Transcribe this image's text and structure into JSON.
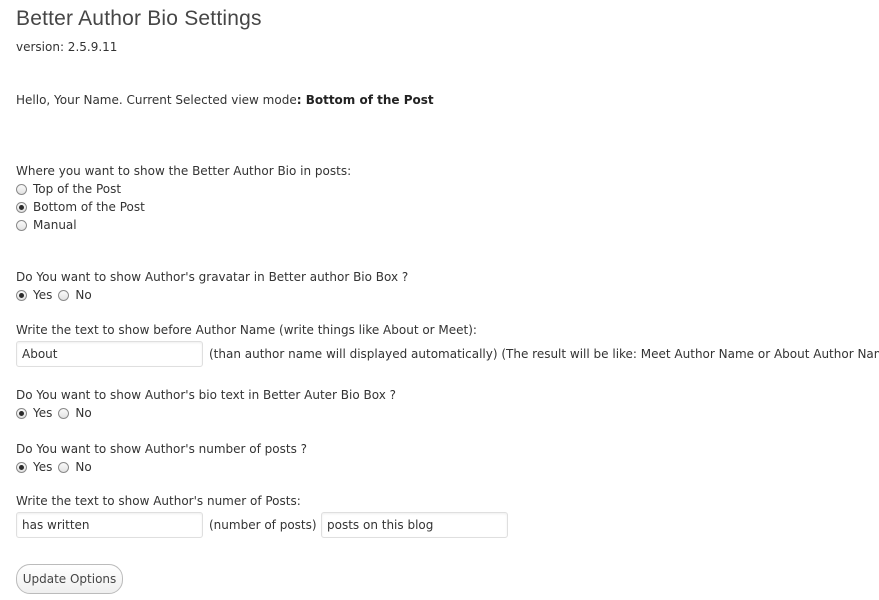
{
  "page": {
    "title": "Better Author Bio Settings",
    "version_label": "version: 2.5.9.11",
    "hello_prefix": "Hello, Your Name. Current Selected view mode",
    "hello_mode": ": Bottom of the Post"
  },
  "position": {
    "question": "Where you want to show the Better Author Bio in posts:",
    "options": [
      {
        "label": "Top of the Post",
        "checked": false
      },
      {
        "label": "Bottom of the Post",
        "checked": true
      },
      {
        "label": "Manual",
        "checked": false
      }
    ]
  },
  "gravatar": {
    "question": "Do You want to show Author's gravatar in Better author Bio Box ?",
    "yes": "Yes",
    "no": "No",
    "selected": "Yes"
  },
  "before_name": {
    "question": "Write the text to show before Author Name (write things like About or Meet):",
    "value": "About",
    "hint": "(than author name will displayed automatically) (The result will be like: Meet Author Name or About Author Name)"
  },
  "bio_text": {
    "question": "Do You want to show Author's bio text in Better Auter Bio Box ?",
    "yes": "Yes",
    "no": "No",
    "selected": "Yes"
  },
  "num_posts": {
    "question": "Do You want to show Author's number of posts ?",
    "yes": "Yes",
    "no": "No",
    "selected": "Yes"
  },
  "posts_text": {
    "question": "Write the text to show Author's numer of Posts:",
    "prefix_value": "has written",
    "middle_label": "(number of posts)",
    "suffix_value": "posts on this blog"
  },
  "submit": {
    "label": "Update Options"
  }
}
